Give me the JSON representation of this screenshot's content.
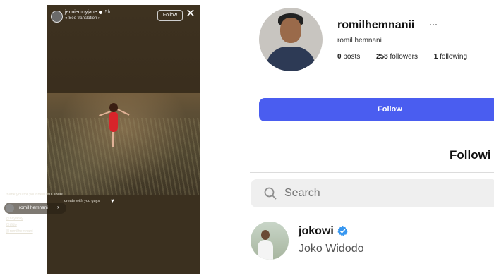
{
  "story": {
    "username": "jennierubyjane",
    "time": "5h",
    "translate": "See translation",
    "follow_label": "Follow",
    "close_icon": "close-icon",
    "caption_line1": "thank you for your beautiful souls",
    "caption_line2": "create with you guys",
    "mention_name": "romil hemnani",
    "tags": [
      "@sayaray",
      "@jfldo",
      "@romilhemnani"
    ]
  },
  "profile": {
    "username": "romilhemnanii",
    "more_label": "···",
    "full_name": "romil hemnani",
    "posts_count": "0",
    "posts_label": "posts",
    "followers_count": "258",
    "followers_label": "followers",
    "following_count": "1",
    "following_label": "following",
    "follow_button": "Follow"
  },
  "following_panel": {
    "title": "Followi",
    "search_placeholder": "Search",
    "users": [
      {
        "handle": "jokowi",
        "name": "Joko Widodo",
        "verified": true
      }
    ]
  },
  "colors": {
    "accent": "#4a5df0",
    "verified": "#3897f0"
  }
}
